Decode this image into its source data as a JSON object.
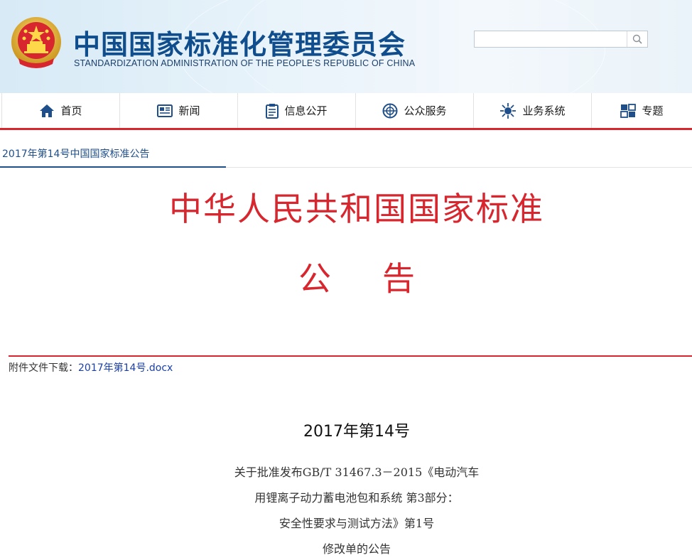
{
  "header": {
    "title_cn": "中国国家标准化管理委员会",
    "title_en": "STANDARDIZATION ADMINISTRATION OF THE PEOPLE'S REPUBLIC OF CHINA",
    "search_placeholder": ""
  },
  "nav": {
    "items": [
      {
        "label": "首页",
        "icon": "home-icon"
      },
      {
        "label": "新闻",
        "icon": "newspaper-icon"
      },
      {
        "label": "信息公开",
        "icon": "clipboard-icon"
      },
      {
        "label": "公众服务",
        "icon": "globe-icon"
      },
      {
        "label": "业务系统",
        "icon": "network-icon"
      },
      {
        "label": "专题",
        "icon": "topic-icon"
      }
    ]
  },
  "breadcrumb": "2017年第14号中国国家标准公告",
  "article": {
    "heading_main": "中华人民共和国国家标准",
    "heading_sub_1": "公",
    "heading_sub_2": "告",
    "attachment_label": "附件文件下载：",
    "attachment_link": "2017年第14号.docx",
    "doc_number": "2017年第14号",
    "body_lines": [
      "关于批准发布GB/T 31467.3－2015《电动汽车",
      "用锂离子动力蓄电池包和系统 第3部分：",
      "安全性要求与测试方法》第1号",
      "修改单的公告"
    ]
  },
  "colors": {
    "brand_blue": "#0f4d8c",
    "accent_red": "#d7262e",
    "link_blue": "#1a3fa8"
  }
}
